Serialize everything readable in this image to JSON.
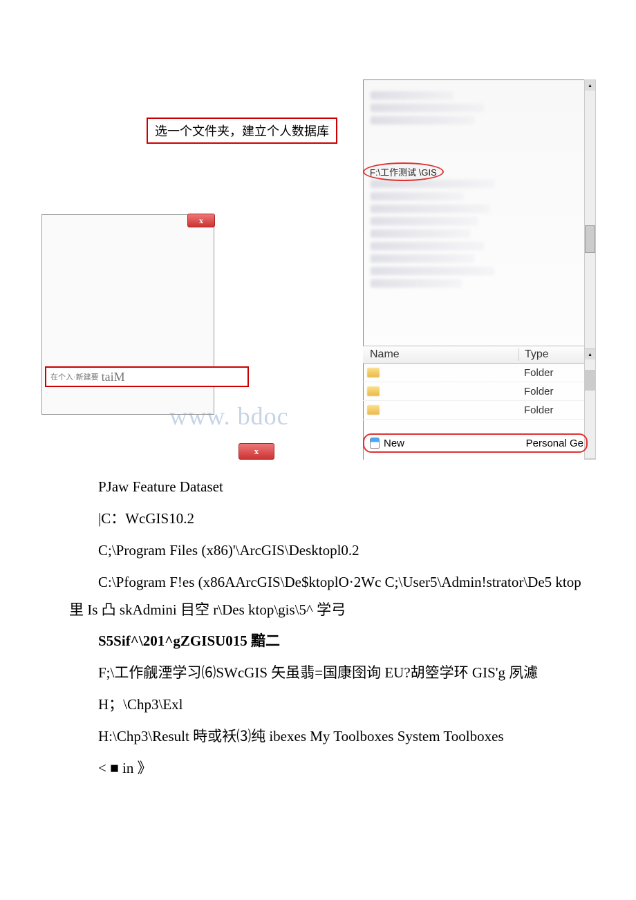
{
  "callout": {
    "folder_label": "选一个文件夹，建立个人数据库"
  },
  "path_tag": "F:\\工作测试   \\GIS",
  "dialog": {
    "close": "x"
  },
  "input": {
    "prefix": "在个入·新建要",
    "main": "taiM"
  },
  "watermark": "www. bdoc",
  "close_bottom": "x",
  "table": {
    "header_name": "Name",
    "header_type": "Type",
    "rows": [
      {
        "name": "",
        "type": "Folder"
      },
      {
        "name": "",
        "type": "Folder"
      },
      {
        "name": "",
        "type": "Folder"
      }
    ],
    "new_row": {
      "name": "New",
      "type": "Personal Ge"
    }
  },
  "text": {
    "p1": "PJaw Feature Dataset",
    "p2": "|C：WcGIS10.2",
    "p3": "C;\\Program Files (x86)'\\ArcGIS\\Desktopl0.2",
    "p4": "C:\\Pfogram F!es (x86AArcGIS\\De$ktoplO·2Wc C;\\User5\\Admin!strator\\De5 ktop 里 Is 凸 skAdmini 目空 r\\Des ktop\\gis\\5^ 学弓",
    "p5": "S5Sif^\\201^gZGISU015 黯二",
    "p6": "F;\\工作觎湮学习⑹SWcGIS 矢虽翡=国康囹询 EU?胡箜学环 GIS'g 夙濾",
    "p7": "H；\\Chp3\\Exl",
    "p8": "H:\\Chp3\\Result 時或袄⑶纯 ibexes My Toolboxes System Toolboxes",
    "p9": "< ■ in 》"
  }
}
